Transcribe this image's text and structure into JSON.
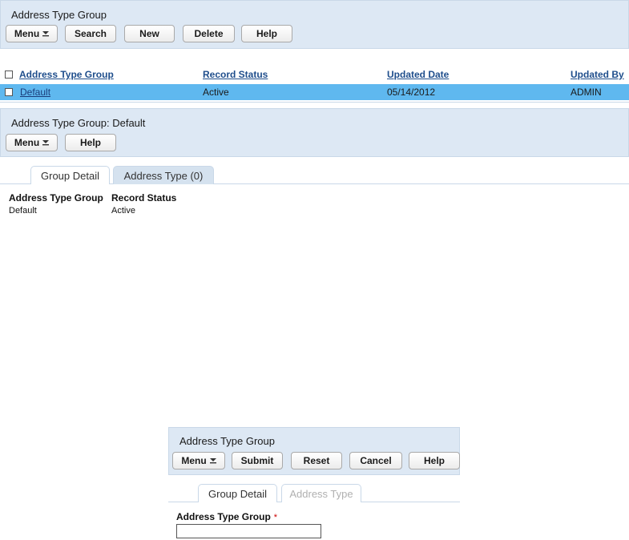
{
  "search_panel": {
    "title": "Address Type Group",
    "buttons": {
      "menu": "Menu",
      "search": "Search",
      "new": "New",
      "delete": "Delete",
      "help": "Help"
    }
  },
  "grid": {
    "columns": [
      "Address Type Group",
      "Record Status",
      "Updated Date",
      "Updated By"
    ],
    "rows": [
      {
        "group": "Default",
        "status": "Active",
        "date": "05/14/2012",
        "by": "ADMIN"
      }
    ]
  },
  "detail_panel": {
    "title": "Address Type Group: Default",
    "buttons": {
      "menu": "Menu",
      "help": "Help"
    },
    "tabs": [
      "Group Detail",
      "Address Type (0)"
    ],
    "fields": [
      {
        "label": "Address Type Group",
        "value": "Default"
      },
      {
        "label": "Record Status",
        "value": "Active"
      }
    ]
  },
  "new_panel": {
    "title": "Address Type Group",
    "buttons": {
      "menu": "Menu",
      "submit": "Submit",
      "reset": "Reset",
      "cancel": "Cancel",
      "help": "Help"
    },
    "tabs": [
      "Group Detail",
      "Address Type"
    ],
    "field": {
      "label": "Address Type Group",
      "required_marker": "*",
      "value": ""
    }
  },
  "colors": {
    "panel_bg": "#dde8f4",
    "selected_row": "#5fb8ef",
    "link": "#1f4e8c",
    "required": "#cc0000"
  }
}
